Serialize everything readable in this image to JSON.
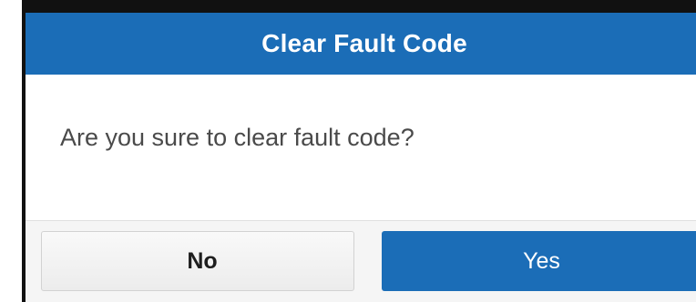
{
  "dialog": {
    "title": "Clear Fault Code",
    "message": "Are you sure to clear fault code?",
    "buttons": {
      "no_label": "No",
      "yes_label": "Yes"
    }
  },
  "colors": {
    "header": "#1b6db7",
    "primary_button": "#1b6db7",
    "secondary_button": "#f0f0f0",
    "message_text": "#4a4a4a"
  }
}
